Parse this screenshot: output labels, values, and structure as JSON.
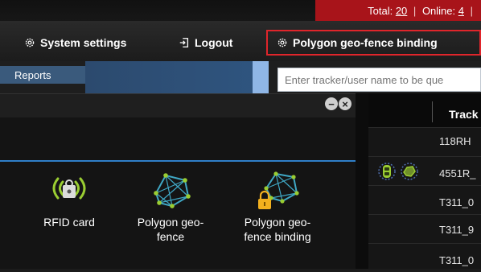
{
  "status": {
    "total_label": "Total: ",
    "total_value": "20",
    "online_label": "Online: ",
    "online_value": "4"
  },
  "nav": {
    "system_settings": "System settings",
    "logout": "Logout",
    "polygon_binding": "Polygon geo-fence binding"
  },
  "toolbar": {
    "reports_tab": "Reports",
    "search_placeholder": "Enter tracker/user name to be que"
  },
  "panel": {
    "tools": [
      {
        "label": "RFID card",
        "icon": "rfid-card-icon"
      },
      {
        "label": "Polygon geo-fence",
        "icon": "polygon-geofence-icon"
      },
      {
        "label": "Polygon geo-fence binding",
        "icon": "polygon-geofence-binding-icon"
      }
    ]
  },
  "table": {
    "header": "Track",
    "rows": [
      "118RH",
      "4551R_",
      "T311_0",
      "T311_9",
      "T311_0"
    ]
  },
  "colors": {
    "status_bar": "#a8141a",
    "highlight": "#e0252b",
    "accent_blue": "#2f7fc8",
    "reports_tab": "#3a5a7c"
  }
}
